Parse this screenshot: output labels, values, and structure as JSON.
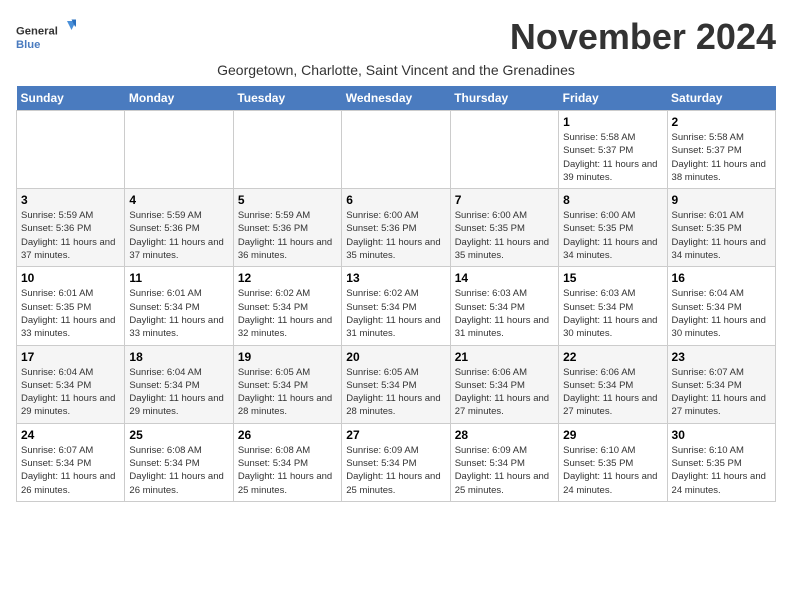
{
  "logo": {
    "text_general": "General",
    "text_blue": "Blue"
  },
  "title": "November 2024",
  "subtitle": "Georgetown, Charlotte, Saint Vincent and the Grenadines",
  "days_of_week": [
    "Sunday",
    "Monday",
    "Tuesday",
    "Wednesday",
    "Thursday",
    "Friday",
    "Saturday"
  ],
  "weeks": [
    [
      {
        "day": "",
        "sunrise": "",
        "sunset": "",
        "daylight": ""
      },
      {
        "day": "",
        "sunrise": "",
        "sunset": "",
        "daylight": ""
      },
      {
        "day": "",
        "sunrise": "",
        "sunset": "",
        "daylight": ""
      },
      {
        "day": "",
        "sunrise": "",
        "sunset": "",
        "daylight": ""
      },
      {
        "day": "",
        "sunrise": "",
        "sunset": "",
        "daylight": ""
      },
      {
        "day": "1",
        "sunrise": "Sunrise: 5:58 AM",
        "sunset": "Sunset: 5:37 PM",
        "daylight": "Daylight: 11 hours and 39 minutes."
      },
      {
        "day": "2",
        "sunrise": "Sunrise: 5:58 AM",
        "sunset": "Sunset: 5:37 PM",
        "daylight": "Daylight: 11 hours and 38 minutes."
      }
    ],
    [
      {
        "day": "3",
        "sunrise": "Sunrise: 5:59 AM",
        "sunset": "Sunset: 5:36 PM",
        "daylight": "Daylight: 11 hours and 37 minutes."
      },
      {
        "day": "4",
        "sunrise": "Sunrise: 5:59 AM",
        "sunset": "Sunset: 5:36 PM",
        "daylight": "Daylight: 11 hours and 37 minutes."
      },
      {
        "day": "5",
        "sunrise": "Sunrise: 5:59 AM",
        "sunset": "Sunset: 5:36 PM",
        "daylight": "Daylight: 11 hours and 36 minutes."
      },
      {
        "day": "6",
        "sunrise": "Sunrise: 6:00 AM",
        "sunset": "Sunset: 5:36 PM",
        "daylight": "Daylight: 11 hours and 35 minutes."
      },
      {
        "day": "7",
        "sunrise": "Sunrise: 6:00 AM",
        "sunset": "Sunset: 5:35 PM",
        "daylight": "Daylight: 11 hours and 35 minutes."
      },
      {
        "day": "8",
        "sunrise": "Sunrise: 6:00 AM",
        "sunset": "Sunset: 5:35 PM",
        "daylight": "Daylight: 11 hours and 34 minutes."
      },
      {
        "day": "9",
        "sunrise": "Sunrise: 6:01 AM",
        "sunset": "Sunset: 5:35 PM",
        "daylight": "Daylight: 11 hours and 34 minutes."
      }
    ],
    [
      {
        "day": "10",
        "sunrise": "Sunrise: 6:01 AM",
        "sunset": "Sunset: 5:35 PM",
        "daylight": "Daylight: 11 hours and 33 minutes."
      },
      {
        "day": "11",
        "sunrise": "Sunrise: 6:01 AM",
        "sunset": "Sunset: 5:34 PM",
        "daylight": "Daylight: 11 hours and 33 minutes."
      },
      {
        "day": "12",
        "sunrise": "Sunrise: 6:02 AM",
        "sunset": "Sunset: 5:34 PM",
        "daylight": "Daylight: 11 hours and 32 minutes."
      },
      {
        "day": "13",
        "sunrise": "Sunrise: 6:02 AM",
        "sunset": "Sunset: 5:34 PM",
        "daylight": "Daylight: 11 hours and 31 minutes."
      },
      {
        "day": "14",
        "sunrise": "Sunrise: 6:03 AM",
        "sunset": "Sunset: 5:34 PM",
        "daylight": "Daylight: 11 hours and 31 minutes."
      },
      {
        "day": "15",
        "sunrise": "Sunrise: 6:03 AM",
        "sunset": "Sunset: 5:34 PM",
        "daylight": "Daylight: 11 hours and 30 minutes."
      },
      {
        "day": "16",
        "sunrise": "Sunrise: 6:04 AM",
        "sunset": "Sunset: 5:34 PM",
        "daylight": "Daylight: 11 hours and 30 minutes."
      }
    ],
    [
      {
        "day": "17",
        "sunrise": "Sunrise: 6:04 AM",
        "sunset": "Sunset: 5:34 PM",
        "daylight": "Daylight: 11 hours and 29 minutes."
      },
      {
        "day": "18",
        "sunrise": "Sunrise: 6:04 AM",
        "sunset": "Sunset: 5:34 PM",
        "daylight": "Daylight: 11 hours and 29 minutes."
      },
      {
        "day": "19",
        "sunrise": "Sunrise: 6:05 AM",
        "sunset": "Sunset: 5:34 PM",
        "daylight": "Daylight: 11 hours and 28 minutes."
      },
      {
        "day": "20",
        "sunrise": "Sunrise: 6:05 AM",
        "sunset": "Sunset: 5:34 PM",
        "daylight": "Daylight: 11 hours and 28 minutes."
      },
      {
        "day": "21",
        "sunrise": "Sunrise: 6:06 AM",
        "sunset": "Sunset: 5:34 PM",
        "daylight": "Daylight: 11 hours and 27 minutes."
      },
      {
        "day": "22",
        "sunrise": "Sunrise: 6:06 AM",
        "sunset": "Sunset: 5:34 PM",
        "daylight": "Daylight: 11 hours and 27 minutes."
      },
      {
        "day": "23",
        "sunrise": "Sunrise: 6:07 AM",
        "sunset": "Sunset: 5:34 PM",
        "daylight": "Daylight: 11 hours and 27 minutes."
      }
    ],
    [
      {
        "day": "24",
        "sunrise": "Sunrise: 6:07 AM",
        "sunset": "Sunset: 5:34 PM",
        "daylight": "Daylight: 11 hours and 26 minutes."
      },
      {
        "day": "25",
        "sunrise": "Sunrise: 6:08 AM",
        "sunset": "Sunset: 5:34 PM",
        "daylight": "Daylight: 11 hours and 26 minutes."
      },
      {
        "day": "26",
        "sunrise": "Sunrise: 6:08 AM",
        "sunset": "Sunset: 5:34 PM",
        "daylight": "Daylight: 11 hours and 25 minutes."
      },
      {
        "day": "27",
        "sunrise": "Sunrise: 6:09 AM",
        "sunset": "Sunset: 5:34 PM",
        "daylight": "Daylight: 11 hours and 25 minutes."
      },
      {
        "day": "28",
        "sunrise": "Sunrise: 6:09 AM",
        "sunset": "Sunset: 5:34 PM",
        "daylight": "Daylight: 11 hours and 25 minutes."
      },
      {
        "day": "29",
        "sunrise": "Sunrise: 6:10 AM",
        "sunset": "Sunset: 5:35 PM",
        "daylight": "Daylight: 11 hours and 24 minutes."
      },
      {
        "day": "30",
        "sunrise": "Sunrise: 6:10 AM",
        "sunset": "Sunset: 5:35 PM",
        "daylight": "Daylight: 11 hours and 24 minutes."
      }
    ]
  ]
}
